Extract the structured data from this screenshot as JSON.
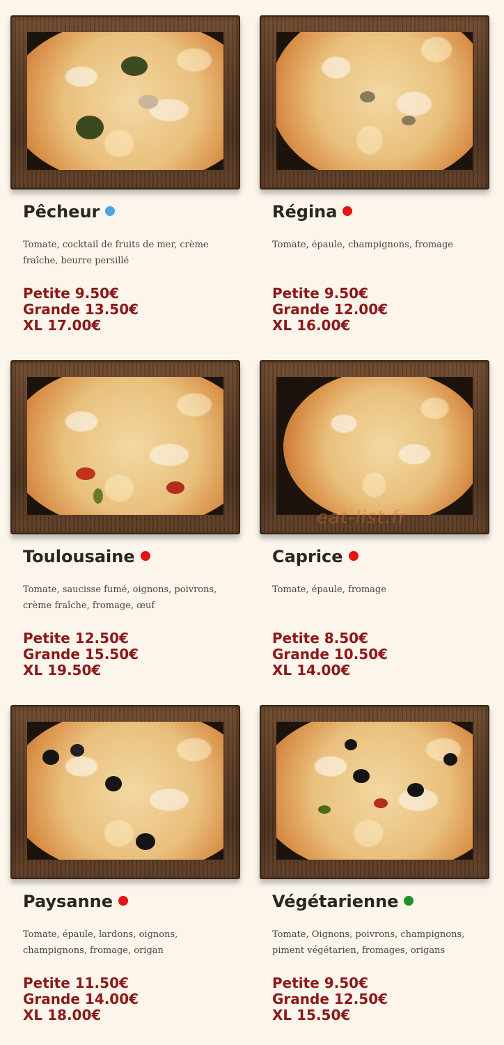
{
  "pizzas": [
    {
      "name": "Pêcheur",
      "dot_color": "#49a5e8",
      "ingredients": "Tomate, cocktail de fruits de mer, crème fraîche, beurre persillé",
      "prices": [
        "Petite 9.50€",
        "Grande 13.50€",
        "XL 17.00€"
      ]
    },
    {
      "name": "Régina",
      "dot_color": "#e31414",
      "ingredients": "Tomate, épaule, champignons, fromage",
      "prices": [
        "Petite 9.50€",
        "Grande 12.00€",
        "XL 16.00€"
      ]
    },
    {
      "name": "Toulousaine",
      "dot_color": "#e31414",
      "ingredients": "Tomate, saucisse fumé, oignons, poivrons, crème fraîche, fromage, œuf",
      "prices": [
        "Petite 12.50€",
        "Grande 15.50€",
        "XL 19.50€"
      ]
    },
    {
      "name": "Caprice",
      "dot_color": "#e31414",
      "ingredients": "Tomate, épaule, fromage",
      "prices": [
        "Petite 8.50€",
        "Grande 10.50€",
        "XL 14.00€"
      ]
    },
    {
      "name": "Paysanne",
      "dot_color": "#e31414",
      "ingredients": "Tomate, épaule, lardons, oignons, champignons, fromage, origan",
      "prices": [
        "Petite 11.50€",
        "Grande 14.00€",
        "XL 18.00€"
      ]
    },
    {
      "name": "Végétarienne",
      "dot_color": "#1f8f2a",
      "ingredients": "Tomate, Oignons, poivrons, champignons, piment végétarien, fromages, origans",
      "prices": [
        "Petite 9.50€",
        "Grande 12.50€",
        "XL 15.50€"
      ]
    }
  ],
  "watermark": "eat-list.fr"
}
